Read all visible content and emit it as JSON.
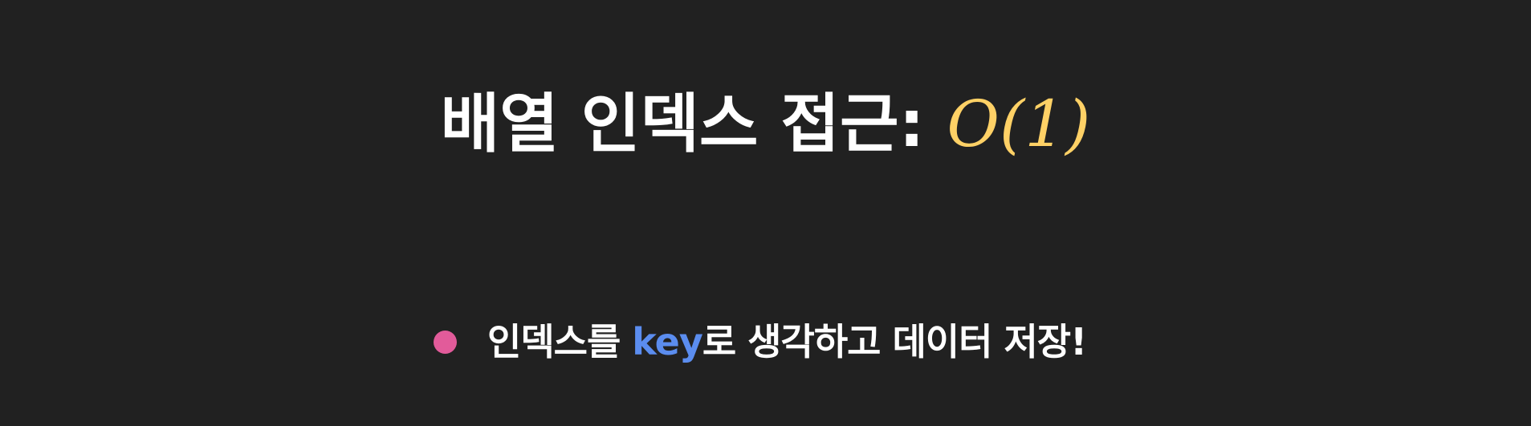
{
  "colors": {
    "background": "#212121",
    "text": "#ffffff",
    "math_accent": "#ffd166",
    "key_accent": "#5b8def",
    "bullet": "#e25b9a"
  },
  "title": {
    "text": "배열 인덱스 접근: ",
    "math": "O(1)"
  },
  "bullets": [
    {
      "before": "인덱스를 ",
      "highlight": "key",
      "after": "로 생각하고 데이터 저장!"
    }
  ]
}
